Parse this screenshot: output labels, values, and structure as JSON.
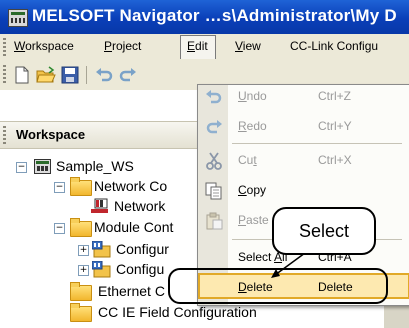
{
  "window": {
    "title": "MELSOFT Navigator …s\\Administrator\\My D",
    "icon": "melsoft-app-icon"
  },
  "menubar": [
    {
      "label": "Workspace",
      "mnemonic": "W"
    },
    {
      "label": "Project",
      "mnemonic": "P"
    },
    {
      "label": "Edit",
      "mnemonic": "E",
      "active": true
    },
    {
      "label": "View",
      "mnemonic": "V"
    },
    {
      "label": "CC-Link Configu",
      "mnemonic": ""
    }
  ],
  "toolbar": {
    "icons": [
      "new-icon",
      "open-icon",
      "save-icon",
      "undo-icon",
      "redo-icon"
    ]
  },
  "workspace_panel": {
    "title": "Workspace"
  },
  "tree": [
    {
      "label": "Sample_WS",
      "icon": "workspace-icon",
      "expander": "⊟"
    },
    {
      "label": "Network Co",
      "icon": "folder-icon",
      "expander": "⊟"
    },
    {
      "label": "Network",
      "icon": "network-icon",
      "expander": ""
    },
    {
      "label": "Module Cont",
      "icon": "folder-icon",
      "expander": "⊟"
    },
    {
      "label": "Configur",
      "icon": "config-icon",
      "expander": "⊞"
    },
    {
      "label": "Configu",
      "icon": "config-icon",
      "expander": "⊞"
    },
    {
      "label": "Ethernet C",
      "icon": "folder-icon",
      "expander": ""
    },
    {
      "label": "CC IE Field Configuration",
      "icon": "folder-icon",
      "expander": ""
    }
  ],
  "edit_menu": [
    {
      "label": "Undo",
      "mnemonic": "U",
      "shortcut": "Ctrl+Z",
      "enabled": false,
      "icon": "undo-icon"
    },
    {
      "label": "Redo",
      "mnemonic": "R",
      "shortcut": "Ctrl+Y",
      "enabled": false,
      "icon": "redo-icon"
    },
    {
      "label": "Cut",
      "mnemonic": "t",
      "shortcut": "Ctrl+X",
      "enabled": false,
      "icon": "cut-icon"
    },
    {
      "label": "Copy",
      "mnemonic": "C",
      "shortcut": "",
      "enabled": true,
      "icon": "copy-icon"
    },
    {
      "label": "Paste",
      "mnemonic": "P",
      "shortcut": "",
      "enabled": false,
      "icon": "paste-icon"
    },
    {
      "label": "Select All",
      "mnemonic": "A",
      "shortcut": "Ctrl+A",
      "enabled": true,
      "icon": ""
    },
    {
      "label": "Delete",
      "mnemonic": "D",
      "shortcut": "Delete",
      "enabled": true,
      "selected": true,
      "icon": ""
    }
  ],
  "callout": {
    "text": "Select"
  },
  "colors": {
    "titlebar": "#0a3fb8",
    "menubar": "#ece9d8",
    "highlight": "#fde9b0",
    "highlight_border": "#e1a928"
  }
}
